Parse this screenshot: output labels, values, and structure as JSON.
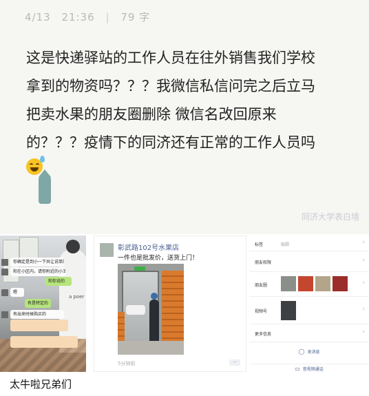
{
  "note": {
    "date": "4/13",
    "time": "21:36",
    "word_count": "79 字",
    "lines": [
      "这是快递驿站的工作人员在往外销售我们学校",
      "拿到的物资吗？？？我微信私信问完之后立马",
      "把卖水果的朋友圈删除  微信名改回原来",
      "的？？？疫情下的同济还有正常的工作人员吗"
    ],
    "emoji": "grinning-sweat-emoji",
    "watermark": "同济大学表白墙"
  },
  "chat_panel": {
    "messages": [
      {
        "text": "你确定是到小一下共让说单的吗？",
        "style": "white"
      },
      {
        "text": "和在小区内，请你附近的小王出来",
        "style": "white"
      },
      {
        "text": "和你说的",
        "style": "green"
      },
      {
        "text": "嗯",
        "style": "white"
      },
      {
        "text": "有是特定的",
        "style": "green"
      },
      {
        "text": "有出来时候购买的",
        "style": "white"
      }
    ],
    "shirt_text": "a poer"
  },
  "moments_panel": {
    "shop_name": "彰武路102号水果店",
    "post_text": "一件也是批发价，送货上门！",
    "timestamp": "5分钟前",
    "more": "··"
  },
  "profile_panel": {
    "rows": [
      {
        "label": "标签",
        "value": "船厨"
      },
      {
        "label": "朋友权限",
        "value": ""
      },
      {
        "label": "朋友圈",
        "value": ""
      },
      {
        "label": "视频号",
        "value": ""
      },
      {
        "label": "更多信息",
        "value": ""
      }
    ],
    "send_message": "发消息",
    "video_call": "音视频通话"
  },
  "caption": "太牛啦兄弟们",
  "colors": {
    "note_bg": "#f6f6f3",
    "wechat_green": "#b6e57c",
    "link_blue": "#4a6090"
  }
}
